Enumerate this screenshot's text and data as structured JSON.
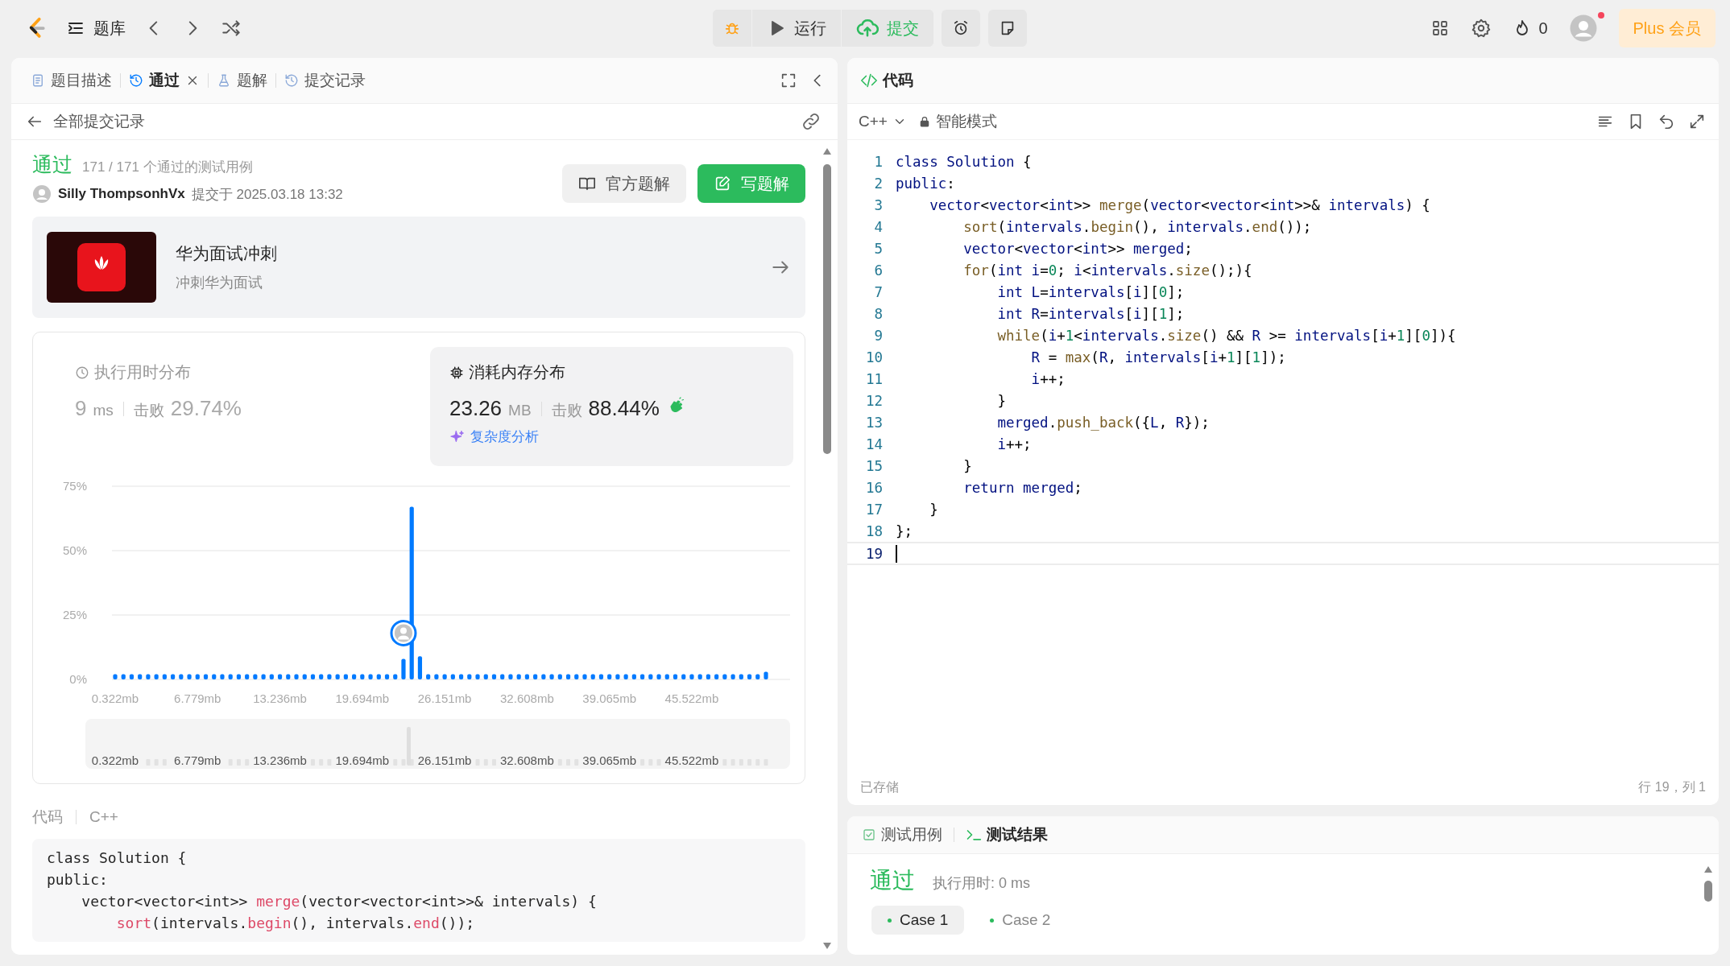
{
  "topbar": {
    "problem_set": "题库",
    "run": "运行",
    "submit": "提交",
    "streak": "0",
    "plus": "Plus 会员",
    "has_notification": true
  },
  "left_tabs": [
    {
      "label": "题目描述",
      "selected": false,
      "closable": false
    },
    {
      "label": "通过",
      "selected": true,
      "closable": true
    },
    {
      "label": "题解",
      "selected": false,
      "closable": false
    },
    {
      "label": "提交记录",
      "selected": false,
      "closable": false
    }
  ],
  "back_link": "全部提交记录",
  "submission": {
    "status": "通过",
    "cases": "171 / 171 个通过的测试用例",
    "user": "Silly ThompsonhVx",
    "submitted": "提交于 2025.03.18 13:32",
    "buttons": [
      {
        "label": "官方题解",
        "kind": "secondary"
      },
      {
        "label": "写题解",
        "kind": "primary"
      }
    ]
  },
  "promo": {
    "title": "华为面试冲刺",
    "subtitle": "冲刺华为面试"
  },
  "stats": [
    {
      "title": "执行用时分布",
      "value": "9",
      "unit": "ms",
      "beats_label": "击败",
      "beats": "29.74%",
      "selected": false
    },
    {
      "title": "消耗内存分布",
      "value": "23.26",
      "unit": "MB",
      "beats_label": "击败",
      "beats": "88.44%",
      "selected": true
    }
  ],
  "complexity_link": "复杂度分析",
  "chart_data": {
    "type": "bar",
    "ylim": [
      0,
      75
    ],
    "categories": [
      "0.322mb",
      null,
      null,
      null,
      null,
      null,
      null,
      null,
      null,
      null,
      "6.779mb",
      null,
      null,
      null,
      null,
      null,
      null,
      null,
      null,
      null,
      "13.236mb",
      null,
      null,
      null,
      null,
      null,
      null,
      null,
      null,
      null,
      "19.694mb",
      null,
      null,
      null,
      null,
      null,
      null,
      null,
      null,
      null,
      "26.151mb",
      null,
      null,
      null,
      null,
      null,
      null,
      null,
      null,
      null,
      "32.608mb",
      null,
      null,
      null,
      null,
      null,
      null,
      null,
      null,
      null,
      "39.065mb",
      null,
      null,
      null,
      null,
      null,
      null,
      null,
      null,
      null,
      "45.522mb",
      null,
      null,
      null,
      null,
      null,
      null,
      null,
      null,
      null
    ],
    "series": [
      {
        "color": "#007aff",
        "values": [
          2,
          2,
          2,
          2,
          2,
          2,
          2,
          2,
          2,
          2,
          2,
          2,
          2,
          2,
          2,
          2,
          2,
          2,
          2,
          2,
          2,
          2,
          2,
          2,
          2,
          2,
          2,
          2,
          2,
          2,
          2,
          2,
          2,
          2,
          2,
          8,
          67,
          9,
          2,
          2,
          2,
          2,
          2,
          2,
          2,
          2,
          2,
          2,
          2,
          2,
          2,
          2,
          2,
          2,
          2,
          2,
          2,
          2,
          2,
          2,
          2,
          2,
          2,
          2,
          2,
          2,
          2,
          2,
          2,
          2,
          2,
          2,
          2,
          2,
          2,
          2,
          2,
          2,
          2,
          3
        ]
      }
    ],
    "yticks": [
      {
        "value": 0,
        "label": "0%"
      },
      {
        "value": 25,
        "label": "25%"
      },
      {
        "value": 50,
        "label": "50%"
      },
      {
        "value": 75,
        "label": "75%"
      }
    ]
  },
  "user_marker_shown": true,
  "overview_labels": [
    "0.322mb",
    "6.779mb",
    "13.236mb",
    "19.694mb",
    "26.151mb",
    "32.608mb",
    "39.065mb",
    "45.522mb"
  ],
  "code_preview": {
    "label": "代码",
    "language": "C++",
    "lines": [
      "class Solution {",
      "public:",
      "    vector<vector<int>> merge(vector<vector<int>>& intervals) {",
      "        sort(intervals.begin(), intervals.end());"
    ]
  },
  "editor": {
    "tab": "代码",
    "language": "C++",
    "mode": "智能模式",
    "saved": "已存储",
    "cursor": "行 19，列 1",
    "lines": [
      {
        "number": "1",
        "text": "class Solution {",
        "current": false
      },
      {
        "number": "2",
        "text": "public:",
        "current": false
      },
      {
        "number": "3",
        "text": "    vector<vector<int>> merge(vector<vector<int>>& intervals) {",
        "current": false
      },
      {
        "number": "4",
        "text": "        sort(intervals.begin(), intervals.end());",
        "current": false
      },
      {
        "number": "5",
        "text": "        vector<vector<int>> merged;",
        "current": false
      },
      {
        "number": "6",
        "text": "        for(int i=0; i<intervals.size();){",
        "current": false
      },
      {
        "number": "7",
        "text": "            int L=intervals[i][0];",
        "current": false
      },
      {
        "number": "8",
        "text": "            int R=intervals[i][1];",
        "current": false
      },
      {
        "number": "9",
        "text": "            while(i+1<intervals.size() && R >= intervals[i+1][0]){",
        "current": false
      },
      {
        "number": "10",
        "text": "                R = max(R, intervals[i+1][1]);",
        "current": false
      },
      {
        "number": "11",
        "text": "                i++;",
        "current": false
      },
      {
        "number": "12",
        "text": "            }",
        "current": false
      },
      {
        "number": "13",
        "text": "            merged.push_back({L, R});",
        "current": false
      },
      {
        "number": "14",
        "text": "            i++;",
        "current": false
      },
      {
        "number": "15",
        "text": "        }",
        "current": false
      },
      {
        "number": "16",
        "text": "        return merged;",
        "current": false
      },
      {
        "number": "17",
        "text": "    }",
        "current": false
      },
      {
        "number": "18",
        "text": "};",
        "current": false
      },
      {
        "number": "19",
        "current": true
      }
    ]
  },
  "tests": {
    "tabs": [
      {
        "label": "测试用例",
        "selected": false
      },
      {
        "label": "测试结果",
        "selected": true
      }
    ],
    "status": "通过",
    "runtime": "执行用时: 0 ms",
    "cases": [
      {
        "label": "Case 1",
        "selected": true
      },
      {
        "label": "Case 2",
        "selected": false
      }
    ]
  }
}
